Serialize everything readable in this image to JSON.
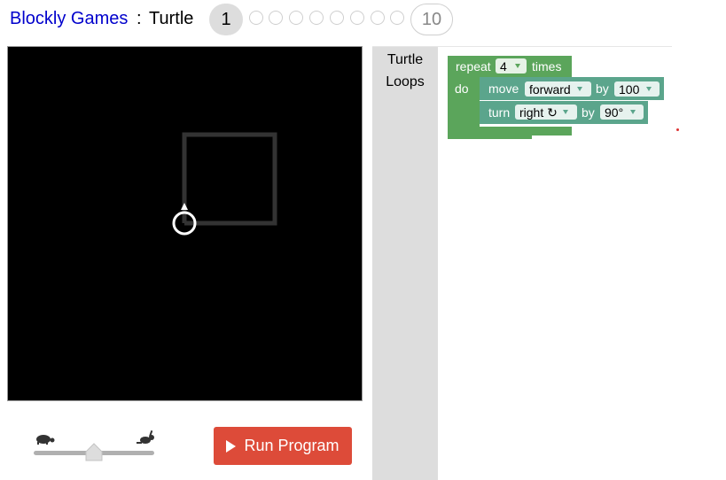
{
  "header": {
    "app_name": "Blockly Games",
    "separator": ":",
    "game_name": "Turtle",
    "current_level": "1",
    "last_level": "10"
  },
  "toolbox": {
    "categories": [
      "Turtle",
      "Loops"
    ]
  },
  "blocks": {
    "repeat": {
      "label": "repeat",
      "count": "4",
      "times_label": "times",
      "do_label": "do"
    },
    "move": {
      "label": "move",
      "direction": "forward",
      "by_label": "by",
      "amount": "100"
    },
    "turn": {
      "label": "turn",
      "direction": "right ↻",
      "by_label": "by",
      "angle": "90°"
    }
  },
  "speed": {
    "slow_icon": "turtle-icon",
    "fast_icon": "rabbit-icon",
    "value": 0.5
  },
  "run_button": {
    "label": "Run Program",
    "icon": "play-icon"
  },
  "colors": {
    "loop_block": "#5ba55b",
    "turtle_block": "#5ba58c",
    "run_button": "#dd4b39",
    "toolbox_bg": "#dddddd",
    "canvas_bg": "#000000",
    "link": "#0000cc"
  }
}
